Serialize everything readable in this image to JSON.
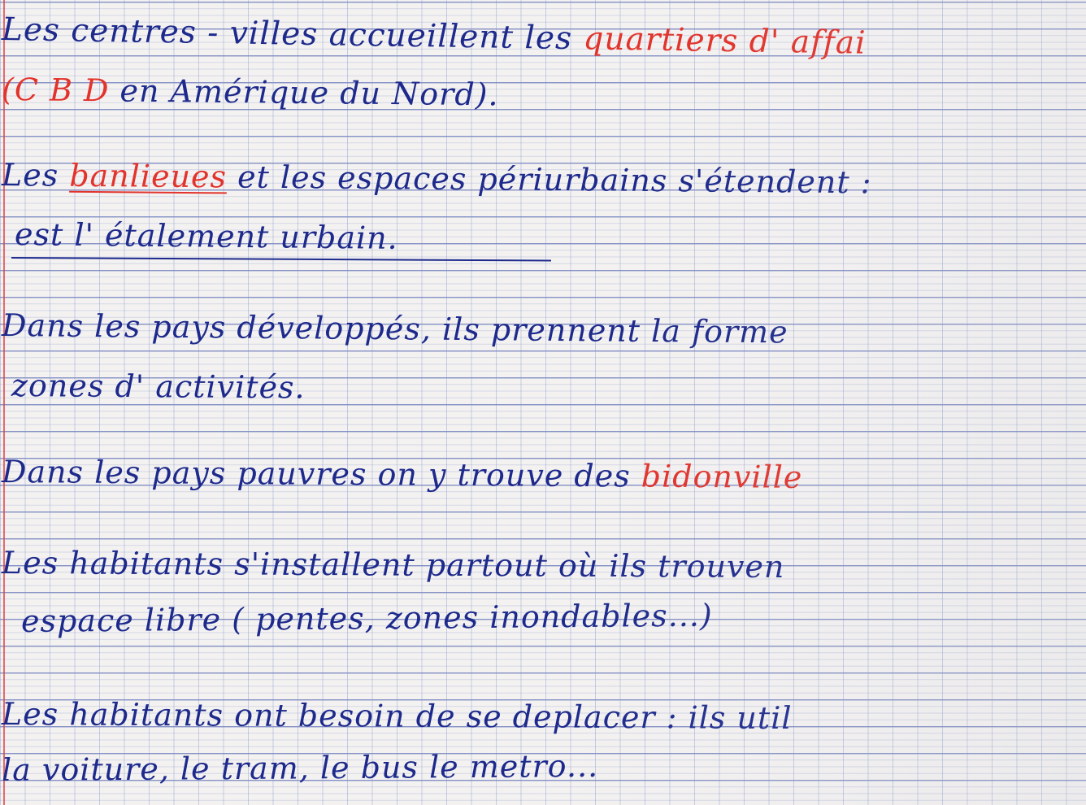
{
  "notes": {
    "line1": {
      "part1": "Les centres - villes accueillent les ",
      "part2": "quartiers d' affai"
    },
    "line2": {
      "part1": "(C B D",
      "part2": " en Amérique du Nord)."
    },
    "line3": {
      "part1": "Les ",
      "part2": "banlieues",
      "part3": " et les espaces périurbains s'étendent :"
    },
    "line4": {
      "part1": "est l' ",
      "part2": "étalement urbain."
    },
    "line5": "Dans les pays développés, ils prennent la forme",
    "line6": "zones d' activités.",
    "line7": {
      "part1": "Dans les pays pauvres on y trouve des ",
      "part2": "bidonville"
    },
    "line8": "Les habitants s'installent partout où ils trouven",
    "line9": "espace libre ( pentes, zones inondables...)",
    "line10": "Les habitants ont besoin de se deplacer : ils util",
    "line11": "la voiture, le tram, le bus le metro..."
  },
  "colors": {
    "ink_blue": "#1d2a8c",
    "ink_red": "#e2332c",
    "margin_red": "#e13c3c",
    "paper": "#f4f2f1",
    "grid": "#7888c8"
  }
}
